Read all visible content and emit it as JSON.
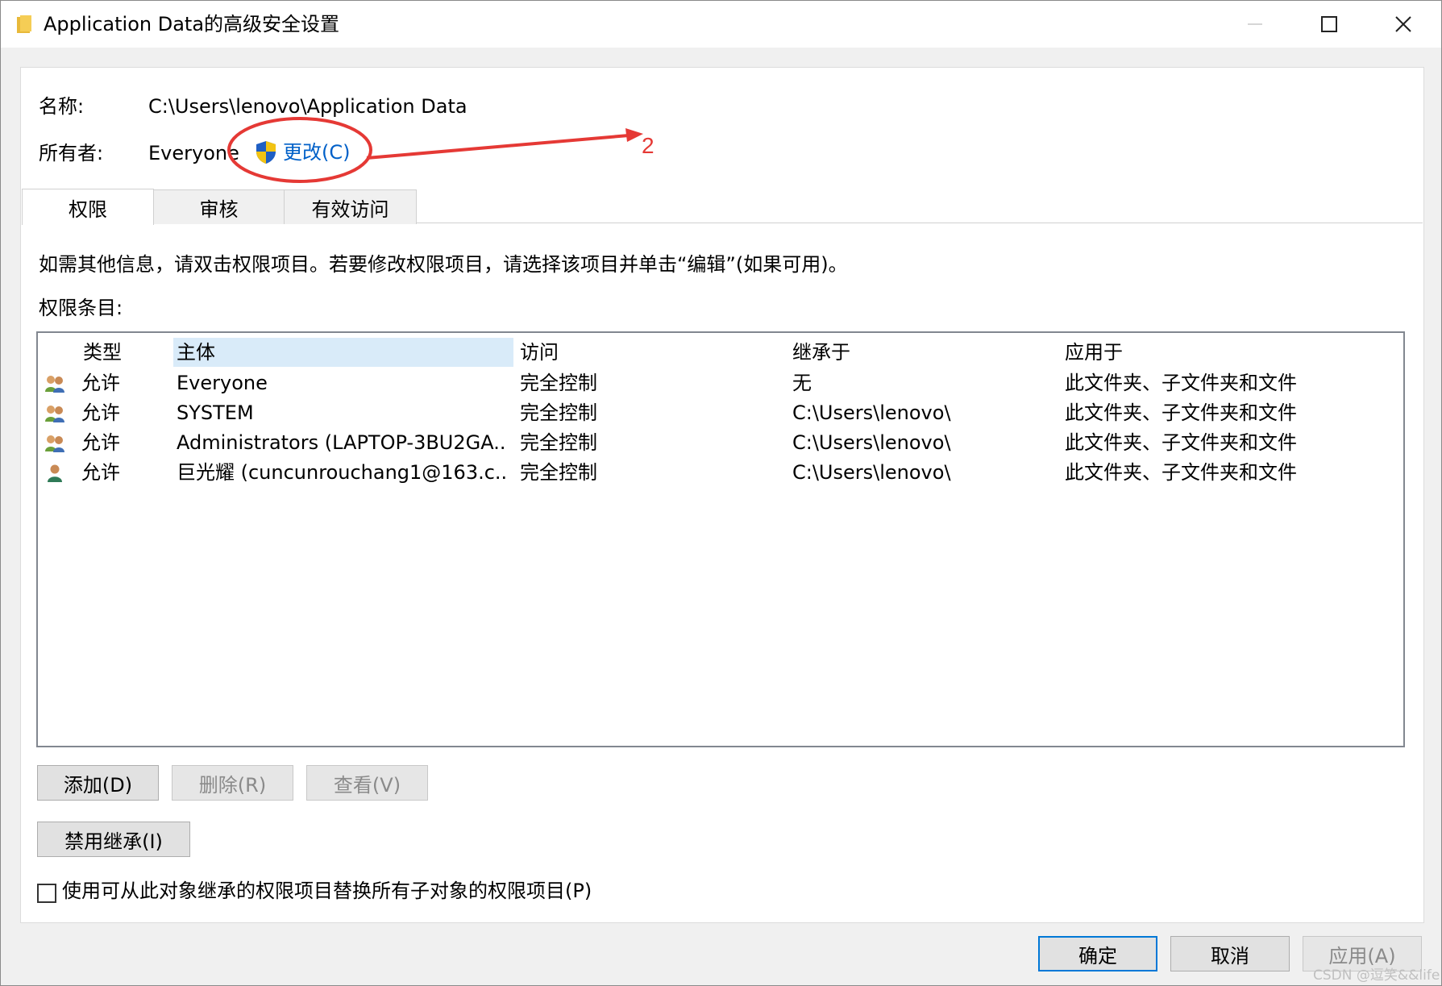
{
  "window": {
    "title": "Application Data的高级安全设置",
    "controls": [
      "minimize",
      "maximize",
      "close"
    ]
  },
  "info": {
    "name_label": "名称:",
    "name_value": "C:\\Users\\lenovo\\Application Data",
    "owner_label": "所有者:",
    "owner_value": "Everyone",
    "owner_change_link": "更改(C)"
  },
  "annotation": {
    "number": "2",
    "color": "#e53935"
  },
  "tabs": [
    {
      "label": "权限",
      "active": true
    },
    {
      "label": "审核",
      "active": false
    },
    {
      "label": "有效访问",
      "active": false
    }
  ],
  "instruction": "如需其他信息，请双击权限项目。若要修改权限项目，请选择该项目并单击“编辑”(如果可用)。",
  "entries_label": "权限条目:",
  "table": {
    "columns": [
      "类型",
      "主体",
      "访问",
      "继承于",
      "应用于"
    ],
    "selected_column": 1,
    "rows": [
      {
        "icon": "group-users-icon",
        "type": "允许",
        "principal": "Everyone",
        "access": "完全控制",
        "inherited_from": "无",
        "applies_to": "此文件夹、子文件夹和文件"
      },
      {
        "icon": "group-users-icon",
        "type": "允许",
        "principal": "SYSTEM",
        "access": "完全控制",
        "inherited_from": "C:\\Users\\lenovo\\",
        "applies_to": "此文件夹、子文件夹和文件"
      },
      {
        "icon": "group-users-icon",
        "type": "允许",
        "principal": "Administrators (LAPTOP-3BU2GA...",
        "access": "完全控制",
        "inherited_from": "C:\\Users\\lenovo\\",
        "applies_to": "此文件夹、子文件夹和文件"
      },
      {
        "icon": "single-user-icon",
        "type": "允许",
        "principal": "巨光耀 (cuncunrouchang1@163.c...",
        "access": "完全控制",
        "inherited_from": "C:\\Users\\lenovo\\",
        "applies_to": "此文件夹、子文件夹和文件"
      }
    ]
  },
  "buttons": {
    "add": "添加(D)",
    "remove": "删除(R)",
    "view": "查看(V)",
    "disable_inheritance": "禁用继承(I)",
    "ok": "确定",
    "cancel": "取消",
    "apply": "应用(A)"
  },
  "replace_checkbox": {
    "label": "使用可从此对象继承的权限项目替换所有子对象的权限项目(P)",
    "checked": false
  },
  "watermark": "CSDN @逗笑&&life"
}
